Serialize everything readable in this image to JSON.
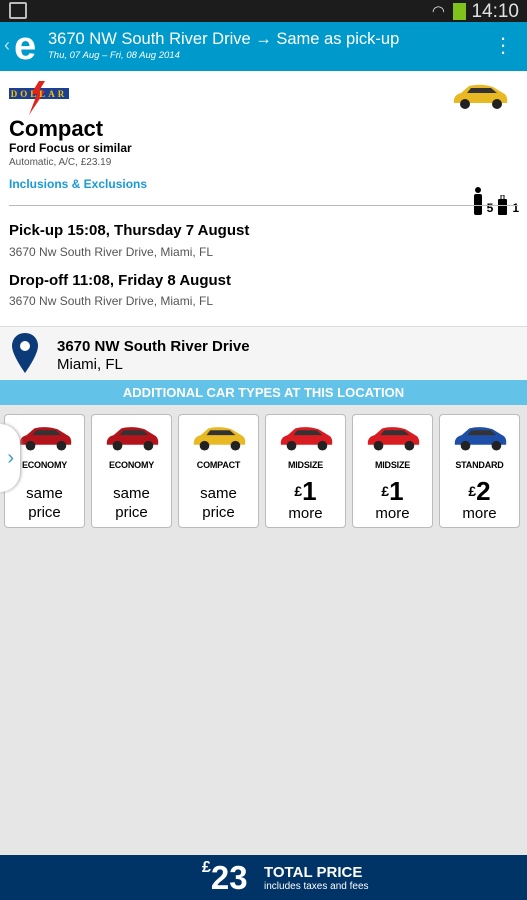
{
  "status_bar": {
    "time": "14:10"
  },
  "header": {
    "title": "3670 NW South River Drive",
    "arrow": "→",
    "dropoff": "Same as pick-up",
    "dates": "Thu, 07 Aug – Fri, 08 Aug 2014"
  },
  "car": {
    "vendor": "DOLLAR",
    "category": "Compact",
    "model": "Ford Focus or similar",
    "features": "Automatic, A/C, £23.19",
    "inclusions_link": "Inclusions & Exclusions",
    "passengers": "5",
    "bags": "1"
  },
  "pickup": {
    "label": "Pick-up  15:08, Thursday 7 August",
    "address": "3670 Nw South River Drive, Miami, FL"
  },
  "dropoff": {
    "label": "Drop-off  11:08, Friday 8 August",
    "address": "3670 Nw South River Drive, Miami, FL"
  },
  "location": {
    "line1": "3670 NW South River Drive",
    "line2": "Miami, FL"
  },
  "additional": {
    "heading": "ADDITIONAL CAR TYPES AT THIS LOCATION",
    "cards": [
      {
        "type": "ECONOMY",
        "line1": "same",
        "line2": "price",
        "color": "#b3141c"
      },
      {
        "type": "ECONOMY",
        "line1": "same",
        "line2": "price",
        "color": "#b3141c"
      },
      {
        "type": "COMPACT",
        "line1": "same",
        "line2": "price",
        "color": "#e8b923"
      },
      {
        "type": "MIDSIZE",
        "currency": "£",
        "amount": "1",
        "line2": "more",
        "color": "#d91c22"
      },
      {
        "type": "MIDSIZE",
        "currency": "£",
        "amount": "1",
        "line2": "more",
        "color": "#d91c22"
      },
      {
        "type": "STANDARD",
        "currency": "£",
        "amount": "2",
        "line2": "more",
        "color": "#1d4fa8"
      }
    ]
  },
  "total": {
    "currency": "£",
    "amount": "23",
    "label": "TOTAL PRICE",
    "note": "includes taxes and fees"
  },
  "colors": {
    "appbar": "#0099cc",
    "banner": "#63c2e8",
    "bottom": "#003366",
    "link": "#1a9ad6"
  }
}
